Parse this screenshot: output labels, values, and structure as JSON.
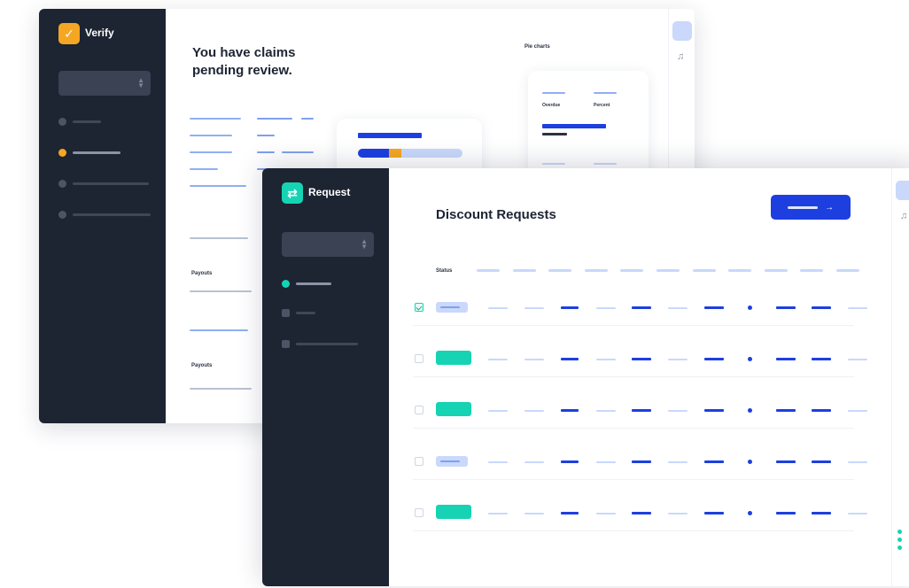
{
  "back_window": {
    "app_name": "Verify",
    "heading": "You have claims pending review.",
    "section_label": "Pie charts",
    "card_labels": [
      "Overdue",
      "Percent"
    ],
    "row_labels": [
      "Payouts",
      "Payouts"
    ],
    "progress": 0.3,
    "sidebar": {
      "active_index": 1,
      "item_count": 4
    }
  },
  "front_window": {
    "app_name": "Request",
    "title": "Discount Requests",
    "status_header": "Status",
    "column_count": 11,
    "sidebar": {
      "active_index": 0,
      "item_count": 3
    },
    "rows": [
      {
        "checked": true,
        "badge": "light"
      },
      {
        "checked": false,
        "badge": "teal"
      },
      {
        "checked": false,
        "badge": "teal"
      },
      {
        "checked": false,
        "badge": "light"
      },
      {
        "checked": false,
        "badge": "teal"
      }
    ]
  },
  "colors": {
    "sidebar": "#1d2432",
    "accent_blue": "#1d3fe0",
    "accent_teal": "#16d3b4",
    "accent_orange": "#f5a623",
    "light_blue": "#c9d8fb"
  }
}
